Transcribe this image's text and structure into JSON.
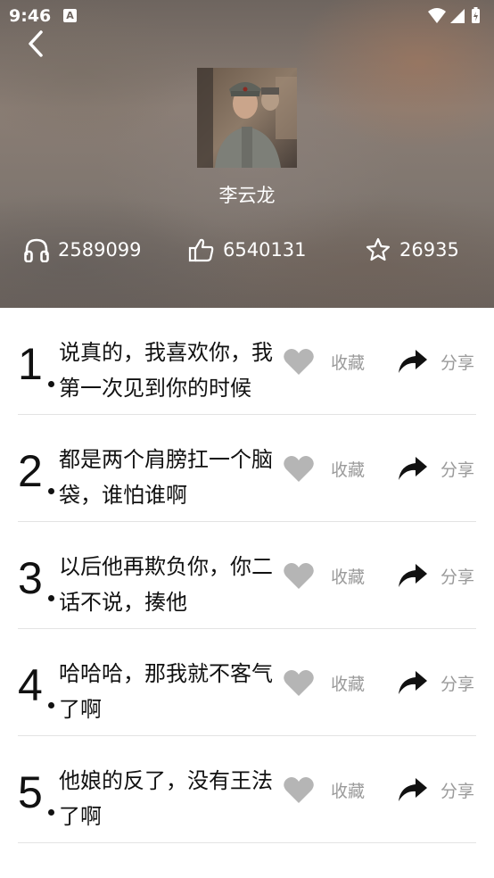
{
  "status_bar": {
    "time": "9:46",
    "app_badge": "A"
  },
  "header": {
    "artist_name": "李云龙",
    "stats": {
      "plays": "2589099",
      "likes": "6540131",
      "favorites": "26935"
    }
  },
  "list": {
    "items": [
      {
        "index": "1",
        "text": "说真的，我喜欢你，我第一次见到你的时候",
        "fav_label": "收藏",
        "share_label": "分享"
      },
      {
        "index": "2",
        "text": "都是两个肩膀扛一个脑袋，谁怕谁啊",
        "fav_label": "收藏",
        "share_label": "分享"
      },
      {
        "index": "3",
        "text": "以后他再欺负你，你二话不说，揍他",
        "fav_label": "收藏",
        "share_label": "分享"
      },
      {
        "index": "4",
        "text": "哈哈哈，那我就不客气了啊",
        "fav_label": "收藏",
        "share_label": "分享"
      },
      {
        "index": "5",
        "text": "他娘的反了，没有王法了啊",
        "fav_label": "收藏",
        "share_label": "分享"
      }
    ]
  },
  "colors": {
    "accent_text": "#111111",
    "muted_label": "#9a9a9a",
    "heart_icon": "#b5b5b5",
    "share_icon": "#111111",
    "divider": "#e3e3e3"
  }
}
